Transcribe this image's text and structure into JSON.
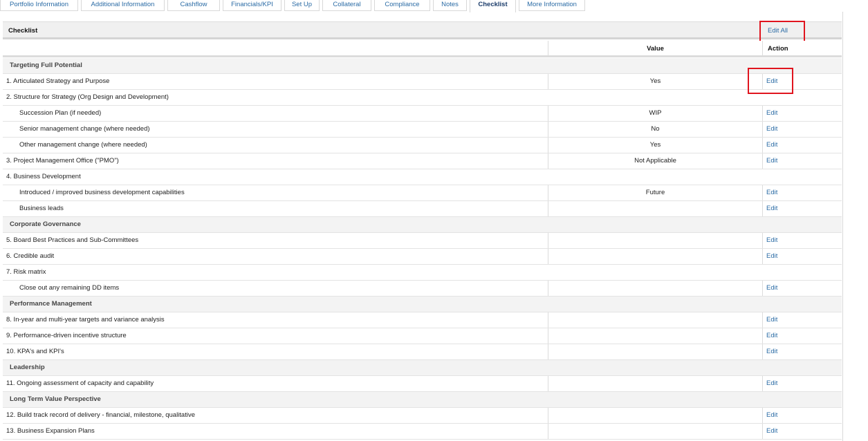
{
  "tabs": [
    {
      "label": "Portfolio Information",
      "active": false
    },
    {
      "label": "Additional Information",
      "active": false
    },
    {
      "label": "Cashflow",
      "active": false
    },
    {
      "label": "Financials/KPI",
      "active": false
    },
    {
      "label": "Set Up",
      "active": false
    },
    {
      "label": "Collateral",
      "active": false
    },
    {
      "label": "Compliance",
      "active": false
    },
    {
      "label": "Notes",
      "active": false
    },
    {
      "label": "Checklist",
      "active": true
    },
    {
      "label": "More Information",
      "active": false
    }
  ],
  "checklist": {
    "title": "Checklist",
    "edit_all_label": "Edit All",
    "columns": {
      "value": "Value",
      "action": "Action"
    },
    "rows": [
      {
        "kind": "section",
        "label": "Targeting Full Potential"
      },
      {
        "kind": "item",
        "label": "1. Articulated Strategy and Purpose",
        "value": "Yes",
        "action": "Edit",
        "highlighted": true
      },
      {
        "kind": "group",
        "label": "2. Structure for Strategy (Org Design and Development)"
      },
      {
        "kind": "sub",
        "label": "Succession Plan (if needed)",
        "value": "WIP",
        "action": "Edit"
      },
      {
        "kind": "sub",
        "label": "Senior management change (where needed)",
        "value": "No",
        "action": "Edit"
      },
      {
        "kind": "sub",
        "label": "Other management change (where needed)",
        "value": "Yes",
        "action": "Edit"
      },
      {
        "kind": "item",
        "label": "3. Project Management Office (\"PMO\")",
        "value": "Not Applicable",
        "action": "Edit"
      },
      {
        "kind": "group",
        "label": "4. Business Development"
      },
      {
        "kind": "sub",
        "label": "Introduced / improved business development capabilities",
        "value": "Future",
        "action": "Edit"
      },
      {
        "kind": "sub",
        "label": "Business leads",
        "value": "",
        "action": "Edit"
      },
      {
        "kind": "section",
        "label": "Corporate Governance"
      },
      {
        "kind": "item",
        "label": "5. Board Best Practices and Sub-Committees",
        "value": "",
        "action": "Edit"
      },
      {
        "kind": "item",
        "label": "6. Credible audit",
        "value": "",
        "action": "Edit"
      },
      {
        "kind": "group",
        "label": "7. Risk matrix"
      },
      {
        "kind": "sub",
        "label": "Close out any remaining DD items",
        "value": "",
        "action": "Edit"
      },
      {
        "kind": "section",
        "label": "Performance Management"
      },
      {
        "kind": "item",
        "label": "8. In-year and multi-year targets and variance analysis",
        "value": "",
        "action": "Edit"
      },
      {
        "kind": "item",
        "label": "9. Performance-driven incentive structure",
        "value": "",
        "action": "Edit"
      },
      {
        "kind": "item",
        "label": "10. KPA's and KPI's",
        "value": "",
        "action": "Edit"
      },
      {
        "kind": "section",
        "label": "Leadership"
      },
      {
        "kind": "item",
        "label": "11. Ongoing assessment of capacity and capability",
        "value": "",
        "action": "Edit"
      },
      {
        "kind": "section",
        "label": "Long Term Value Perspective"
      },
      {
        "kind": "item",
        "label": "12. Build track record of delivery - financial, milestone, qualitative",
        "value": "",
        "action": "Edit"
      },
      {
        "kind": "item",
        "label": "13. Business Expansion Plans",
        "value": "",
        "action": "Edit"
      }
    ]
  },
  "colors": {
    "link": "#2a6ba5",
    "highlight": "#e0141e",
    "section_bg": "#f3f3f3"
  }
}
